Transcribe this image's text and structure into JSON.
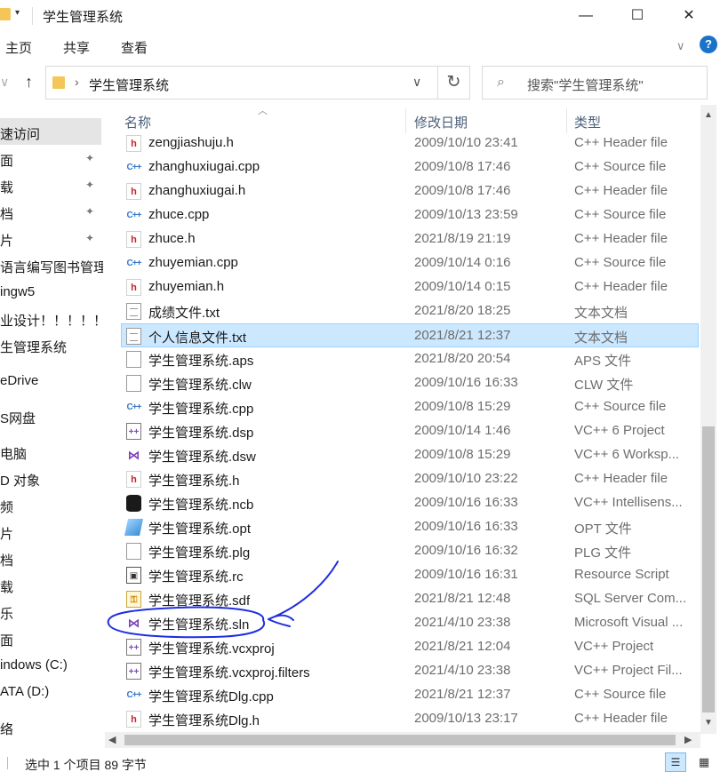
{
  "window": {
    "title": "学生管理系统",
    "minimize": "—",
    "maximize": "☐",
    "close": "✕",
    "quick_access_dropdown": "▾"
  },
  "ribbon": {
    "tabs": [
      "主页",
      "共享",
      "查看"
    ],
    "expand": "∨",
    "help": "?"
  },
  "address": {
    "path": "学生管理系统",
    "chevron": "›",
    "dropdown": "∨",
    "refresh": "↻"
  },
  "search": {
    "placeholder": "搜索\"学生管理系统\"",
    "icon": "search-icon"
  },
  "nav_pane": {
    "items": [
      {
        "label": "速访问",
        "selected": true
      },
      {
        "label": "面",
        "pinned": true
      },
      {
        "label": "载",
        "pinned": true
      },
      {
        "label": "档",
        "pinned": true
      },
      {
        "label": "片",
        "pinned": true
      },
      {
        "label": "语言编写图书管理"
      },
      {
        "label": "ingw5"
      },
      {
        "label": "业设计！！！！！"
      },
      {
        "label": "生管理系统"
      },
      {
        "label": "eDrive"
      },
      {
        "label": "S网盘"
      },
      {
        "label": "电脑"
      },
      {
        "label": "D 对象"
      },
      {
        "label": "频"
      },
      {
        "label": "片"
      },
      {
        "label": "档"
      },
      {
        "label": "载"
      },
      {
        "label": "乐"
      },
      {
        "label": "面"
      },
      {
        "label": "indows (C:)"
      },
      {
        "label": "ATA (D:)"
      },
      {
        "label": "络"
      }
    ],
    "pin_glyph": "📌"
  },
  "columns": {
    "name": "名称",
    "date": "修改日期",
    "type": "类型"
  },
  "files": [
    {
      "icon": "h",
      "name": "zengjiashuju.h",
      "date": "2009/10/10 23:41",
      "type": "C++ Header file"
    },
    {
      "icon": "cpp",
      "name": "zhanghuxiugai.cpp",
      "date": "2009/10/8 17:46",
      "type": "C++ Source file"
    },
    {
      "icon": "h",
      "name": "zhanghuxiugai.h",
      "date": "2009/10/8 17:46",
      "type": "C++ Header file"
    },
    {
      "icon": "cpp",
      "name": "zhuce.cpp",
      "date": "2009/10/13 23:59",
      "type": "C++ Source file"
    },
    {
      "icon": "h",
      "name": "zhuce.h",
      "date": "2021/8/19 21:19",
      "type": "C++ Header file"
    },
    {
      "icon": "cpp",
      "name": "zhuyemian.cpp",
      "date": "2009/10/14 0:16",
      "type": "C++ Source file"
    },
    {
      "icon": "h",
      "name": "zhuyemian.h",
      "date": "2009/10/14 0:15",
      "type": "C++ Header file"
    },
    {
      "icon": "txt",
      "name": "成绩文件.txt",
      "date": "2021/8/20 18:25",
      "type": "文本文档"
    },
    {
      "icon": "txt",
      "name": "个人信息文件.txt",
      "date": "2021/8/21 12:37",
      "type": "文本文档",
      "selected": true
    },
    {
      "icon": "blank",
      "name": "学生管理系统.aps",
      "date": "2021/8/20 20:54",
      "type": "APS 文件"
    },
    {
      "icon": "blank",
      "name": "学生管理系统.clw",
      "date": "2009/10/16 16:33",
      "type": "CLW 文件"
    },
    {
      "icon": "cpp",
      "name": "学生管理系统.cpp",
      "date": "2009/10/8 15:29",
      "type": "C++ Source file"
    },
    {
      "icon": "proj",
      "name": "学生管理系统.dsp",
      "date": "2009/10/14 1:46",
      "type": "VC++ 6 Project"
    },
    {
      "icon": "vs",
      "name": "学生管理系统.dsw",
      "date": "2009/10/8 15:29",
      "type": "VC++ 6 Worksp..."
    },
    {
      "icon": "h",
      "name": "学生管理系统.h",
      "date": "2009/10/10 23:22",
      "type": "C++ Header file"
    },
    {
      "icon": "db",
      "name": "学生管理系统.ncb",
      "date": "2009/10/16 16:33",
      "type": "VC++ Intellisens..."
    },
    {
      "icon": "opt",
      "name": "学生管理系统.opt",
      "date": "2009/10/16 16:33",
      "type": "OPT 文件"
    },
    {
      "icon": "blank",
      "name": "学生管理系统.plg",
      "date": "2009/10/16 16:32",
      "type": "PLG 文件"
    },
    {
      "icon": "rc",
      "name": "学生管理系统.rc",
      "date": "2009/10/16 16:31",
      "type": "Resource Script"
    },
    {
      "icon": "sdf",
      "name": "学生管理系统.sdf",
      "date": "2021/8/21 12:48",
      "type": "SQL Server Com..."
    },
    {
      "icon": "vs",
      "name": "学生管理系统.sln",
      "date": "2021/4/10 23:38",
      "type": "Microsoft Visual ..."
    },
    {
      "icon": "proj",
      "name": "学生管理系统.vcxproj",
      "date": "2021/8/21 12:04",
      "type": "VC++ Project"
    },
    {
      "icon": "proj",
      "name": "学生管理系统.vcxproj.filters",
      "date": "2021/4/10 23:38",
      "type": "VC++ Project Fil..."
    },
    {
      "icon": "cpp",
      "name": "学生管理系统Dlg.cpp",
      "date": "2021/8/21 12:37",
      "type": "C++ Source file"
    },
    {
      "icon": "h",
      "name": "学生管理系统Dlg.h",
      "date": "2009/10/13 23:17",
      "type": "C++ Header file"
    }
  ],
  "status": {
    "text": "选中 1 个项目  89 字节"
  },
  "colors": {
    "selection_bg": "#cce8ff",
    "annotation_ink": "#1f2ee0"
  }
}
